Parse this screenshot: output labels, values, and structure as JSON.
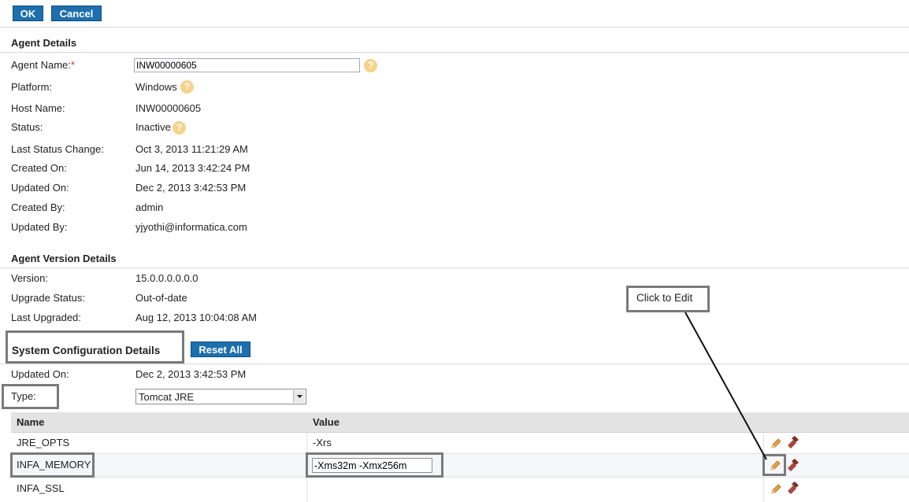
{
  "toolbar": {
    "ok_label": "OK",
    "cancel_label": "Cancel"
  },
  "agent_details": {
    "title": "Agent Details",
    "name_label": "Agent Name:",
    "required_mark": "*",
    "name_value": "INW00000605",
    "platform_label": "Platform:",
    "platform_value": "Windows",
    "host_label": "Host Name:",
    "host_value": "INW00000605",
    "status_label": "Status:",
    "status_value": "Inactive",
    "last_status_label": "Last Status Change:",
    "last_status_value": "Oct 3, 2013 11:21:29 AM",
    "created_on_label": "Created On:",
    "created_on_value": "Jun 14, 2013 3:42:24 PM",
    "updated_on_label": "Updated On:",
    "updated_on_value": "Dec 2, 2013 3:42:53 PM",
    "created_by_label": "Created By:",
    "created_by_value": "admin",
    "updated_by_label": "Updated By:",
    "updated_by_value": "yjyothi@informatica.com"
  },
  "version_details": {
    "title": "Agent Version Details",
    "version_label": "Version:",
    "version_value": "15.0.0.0.0.0.0",
    "upgrade_label": "Upgrade Status:",
    "upgrade_value": "Out-of-date",
    "last_upgraded_label": "Last Upgraded:",
    "last_upgraded_value": "Aug 12, 2013 10:04:08 AM"
  },
  "system_config": {
    "title": "System Configuration Details",
    "reset_label": "Reset All",
    "updated_on_label": "Updated On:",
    "updated_on_value": "Dec 2, 2013 3:42:53 PM",
    "type_label": "Type:",
    "type_value": "Tomcat JRE",
    "columns": {
      "name": "Name",
      "value": "Value"
    },
    "rows": [
      {
        "name": "JRE_OPTS",
        "value": "-Xrs"
      },
      {
        "name": "INFA_MEMORY",
        "value": "-Xms32m -Xmx256m"
      },
      {
        "name": "INFA_SSL",
        "value": ""
      }
    ]
  },
  "callout": {
    "text": "Click to Edit"
  },
  "icons": {
    "help": "help-icon",
    "edit": "pencil-icon",
    "delete": "delete-icon"
  }
}
